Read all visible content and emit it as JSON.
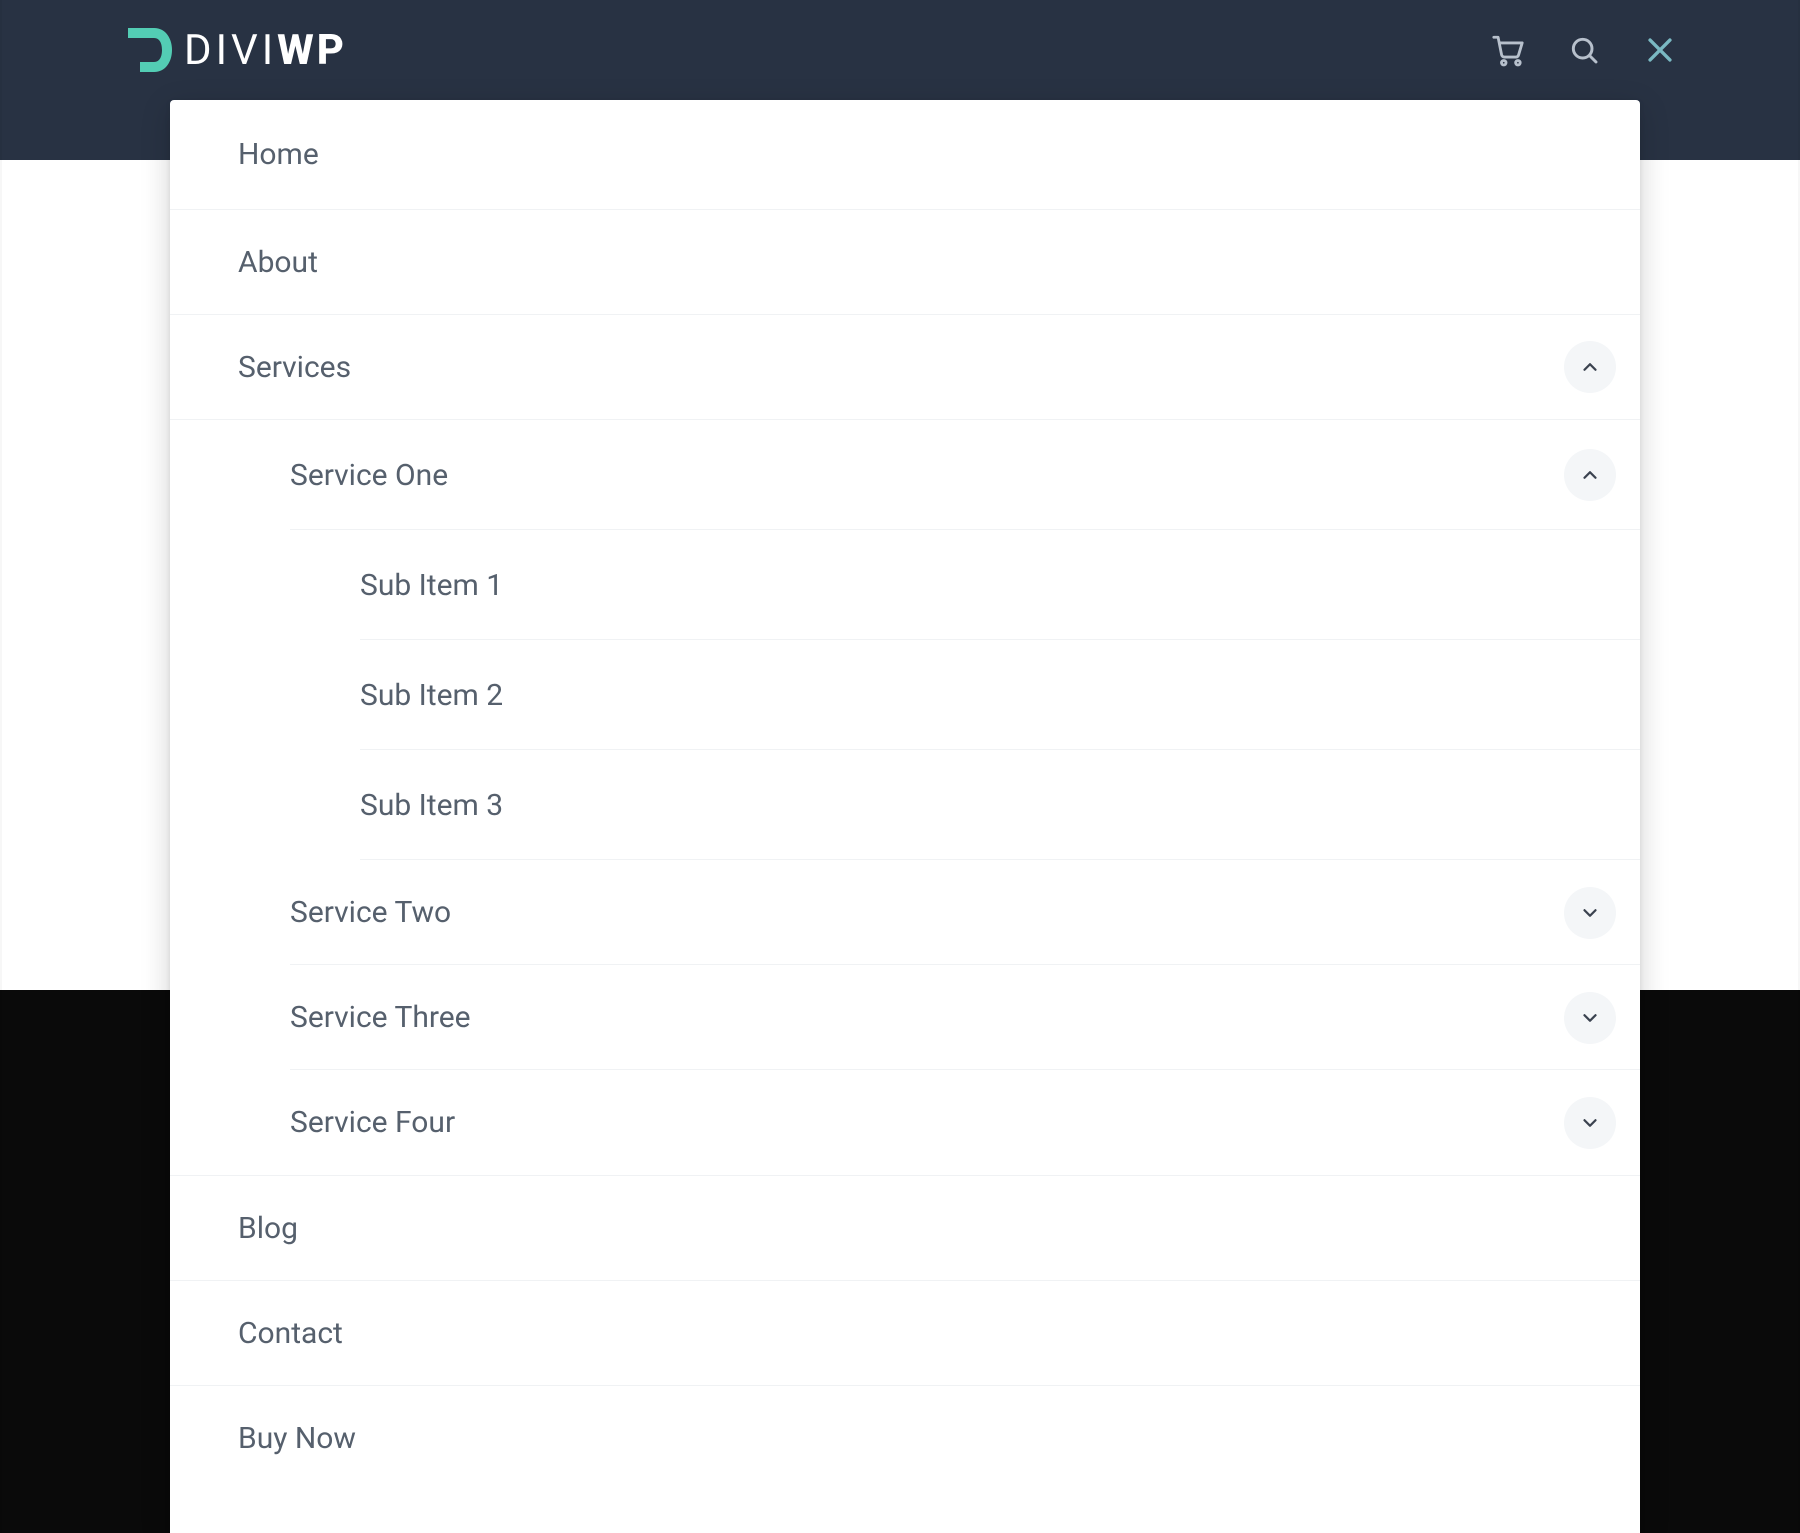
{
  "brand": {
    "logo_text_part1": "DIVI",
    "logo_text_part2": "WP",
    "accent_color": "#53cdb4",
    "header_bg": "#283243"
  },
  "topbar": {
    "icons": {
      "cart": "cart-icon",
      "search": "search-icon",
      "close": "close-icon"
    }
  },
  "menu": {
    "items": [
      {
        "label": "Home"
      },
      {
        "label": "About"
      },
      {
        "label": "Services",
        "expanded": true,
        "children": [
          {
            "label": "Service One",
            "expanded": true,
            "children": [
              {
                "label": "Sub Item 1"
              },
              {
                "label": "Sub Item 2"
              },
              {
                "label": "Sub Item 3"
              }
            ]
          },
          {
            "label": "Service Two",
            "expanded": false,
            "has_children": true
          },
          {
            "label": "Service Three",
            "expanded": false,
            "has_children": true
          },
          {
            "label": "Service Four",
            "expanded": false,
            "has_children": true
          }
        ]
      },
      {
        "label": "Blog"
      },
      {
        "label": "Contact"
      },
      {
        "label": "Buy Now"
      }
    ]
  }
}
